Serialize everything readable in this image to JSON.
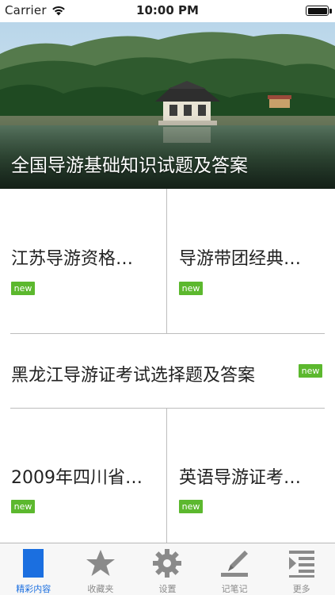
{
  "status_bar": {
    "carrier": "Carrier",
    "time": "10:00 PM"
  },
  "hero": {
    "title": "全国导游基础知识试题及答案"
  },
  "articles": [
    {
      "title": "江苏导游资格…",
      "badge": "new"
    },
    {
      "title": "导游带团经典…",
      "badge": "new"
    },
    {
      "title": "黑龙江导游证考试选择题及答案",
      "badge": "new"
    },
    {
      "title": "2009年四川省…",
      "badge": "new"
    },
    {
      "title": "英语导游证考…",
      "badge": "new"
    }
  ],
  "tab_bar": {
    "active_color": "#1b6fe0",
    "inactive_color": "#8a8a8a",
    "tabs": [
      {
        "label": "精彩内容",
        "icon": "bookmark-rect-icon",
        "active": true
      },
      {
        "label": "收藏夹",
        "icon": "star-icon",
        "active": false
      },
      {
        "label": "设置",
        "icon": "gear-icon",
        "active": false
      },
      {
        "label": "记笔记",
        "icon": "pencil-icon",
        "active": false
      },
      {
        "label": "更多",
        "icon": "more-list-icon",
        "active": false
      }
    ]
  },
  "colors": {
    "badge": "#5cb82e",
    "divider": "#bdbdbd"
  }
}
